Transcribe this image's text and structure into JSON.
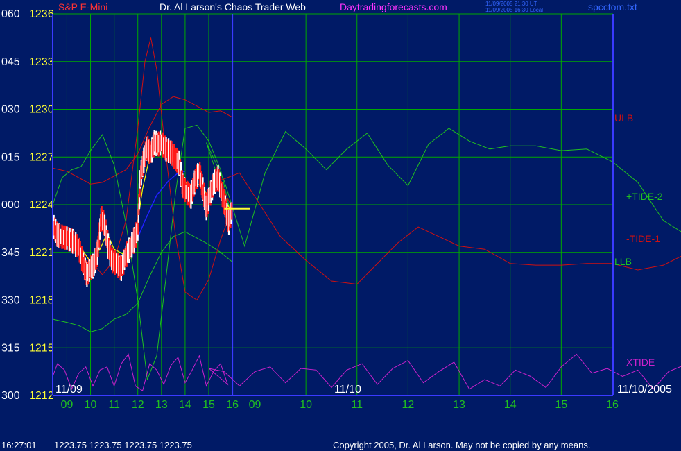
{
  "colors": {
    "background": "#001a66",
    "grid": "#00aa00",
    "axis": "#3a3aff",
    "price_up": "#ffffff",
    "price_down": "#ff1a1a",
    "ma_fast": "#ffff00",
    "ma_slow": "#2020ff",
    "ulb": "#d01010",
    "llb": "#20c020",
    "tide_plus2": "#20c020",
    "tide_minus1": "#d01010",
    "xtide": "#cc22cc",
    "label_yellow": "#ffff33",
    "label_white": "#ffffff",
    "title_white": "#ffffff",
    "title_magenta": "#ff33ff",
    "instrument_red": "#ff3333",
    "clock_blue": "#3366ff"
  },
  "header": {
    "instrument": "S&P E-Mini",
    "site_name": "Dr. Al Larson's Chaos Trader Web",
    "site_url": "Daytradingforecasts.com",
    "time_ut": "11/09/2005 21:30 UT",
    "time_local": "11/09/2005 16:30 Local",
    "filename": "spcctom.txt"
  },
  "chart_data": {
    "type": "line",
    "title": "S&P E-Mini",
    "xlabel": "",
    "ylabel": "",
    "y_left_degree_ticks": [
      "060",
      "045",
      "030",
      "015",
      "000",
      "345",
      "330",
      "315",
      "300"
    ],
    "y_left_price_ticks": [
      "1236",
      "1233",
      "1230",
      "1227",
      "1224",
      "1221",
      "1218",
      "1215",
      "1212"
    ],
    "ylim": [
      1212,
      1236
    ],
    "x_hour_ticks": [
      "09",
      "10",
      "11",
      "12",
      "13",
      "14",
      "15",
      "16",
      "09",
      "10",
      "11",
      "12",
      "13",
      "14",
      "15",
      "16"
    ],
    "x_date_labels": [
      "11/09",
      "11/10",
      "11/10/2005"
    ],
    "x_range_hours": [
      8.4,
      32.1
    ],
    "series_labels": {
      "ulb": "ULB",
      "tide_plus2": "+TIDE-2",
      "tide_minus1": "-TIDE-1",
      "llb": "LLB",
      "xtide": "XTIDE"
    },
    "price_bars": [
      [
        8.45,
        1222.6
      ],
      [
        8.6,
        1222.1
      ],
      [
        8.75,
        1222.0
      ],
      [
        9.0,
        1221.9
      ],
      [
        9.25,
        1221.7
      ],
      [
        9.5,
        1221.3
      ],
      [
        9.7,
        1220.3
      ],
      [
        9.85,
        1219.6
      ],
      [
        10.0,
        1220.0
      ],
      [
        10.15,
        1220.2
      ],
      [
        10.3,
        1221.0
      ],
      [
        10.45,
        1223.2
      ],
      [
        10.6,
        1222.7
      ],
      [
        10.75,
        1221.4
      ],
      [
        10.9,
        1220.5
      ],
      [
        11.1,
        1220.3
      ],
      [
        11.3,
        1220.0
      ],
      [
        11.5,
        1220.8
      ],
      [
        11.7,
        1221.3
      ],
      [
        11.85,
        1221.8
      ],
      [
        12.0,
        1222.4
      ],
      [
        12.1,
        1225.6
      ],
      [
        12.25,
        1226.8
      ],
      [
        12.4,
        1227.6
      ],
      [
        12.55,
        1227.2
      ],
      [
        12.7,
        1227.9
      ],
      [
        12.85,
        1227.8
      ],
      [
        13.0,
        1227.9
      ],
      [
        13.2,
        1227.5
      ],
      [
        13.4,
        1227.3
      ],
      [
        13.6,
        1226.9
      ],
      [
        13.75,
        1226.6
      ],
      [
        13.9,
        1225.2
      ],
      [
        14.05,
        1224.8
      ],
      [
        14.25,
        1224.5
      ],
      [
        14.4,
        1225.4
      ],
      [
        14.6,
        1226.1
      ],
      [
        14.75,
        1225.0
      ],
      [
        14.9,
        1223.8
      ],
      [
        15.05,
        1224.6
      ],
      [
        15.2,
        1225.3
      ],
      [
        15.4,
        1225.7
      ],
      [
        15.55,
        1224.8
      ],
      [
        15.7,
        1223.9
      ],
      [
        15.85,
        1222.9
      ],
      [
        16.0,
        1223.75
      ]
    ],
    "ma_fast_points": [
      [
        8.45,
        1222.6
      ],
      [
        9.0,
        1222.0
      ],
      [
        9.5,
        1221.5
      ],
      [
        10.0,
        1220.4
      ],
      [
        10.4,
        1221.2
      ],
      [
        10.7,
        1222.2
      ],
      [
        11.0,
        1221.2
      ],
      [
        11.5,
        1220.8
      ],
      [
        11.9,
        1221.9
      ],
      [
        12.2,
        1225.0
      ],
      [
        12.5,
        1227.0
      ],
      [
        12.8,
        1227.6
      ],
      [
        13.1,
        1227.6
      ],
      [
        13.5,
        1227.0
      ],
      [
        13.8,
        1226.3
      ],
      [
        14.1,
        1225.1
      ],
      [
        14.4,
        1225.2
      ],
      [
        14.7,
        1225.3
      ],
      [
        15.0,
        1224.4
      ],
      [
        15.3,
        1225.1
      ],
      [
        15.55,
        1225.2
      ],
      [
        15.8,
        1224.0
      ],
      [
        16.0,
        1223.4
      ]
    ],
    "ma_slow_points": [
      [
        11.3,
        1220.6
      ],
      [
        11.8,
        1221.2
      ],
      [
        12.3,
        1223.0
      ],
      [
        12.8,
        1224.6
      ],
      [
        13.3,
        1225.5
      ],
      [
        13.7,
        1226.0
      ],
      [
        14.0,
        1226.1
      ]
    ],
    "ulb_points": [
      [
        8.4,
        1226.3
      ],
      [
        9.0,
        1226.1
      ],
      [
        9.5,
        1225.7
      ],
      [
        10.0,
        1225.3
      ],
      [
        10.5,
        1225.4
      ],
      [
        11.0,
        1225.8
      ],
      [
        11.5,
        1226.2
      ],
      [
        12.0,
        1227.2
      ],
      [
        12.5,
        1228.9
      ],
      [
        13.0,
        1230.3
      ],
      [
        13.5,
        1230.8
      ],
      [
        14.0,
        1230.6
      ],
      [
        14.5,
        1230.2
      ],
      [
        15.0,
        1229.8
      ],
      [
        15.5,
        1229.9
      ],
      [
        16.0,
        1229.5
      ]
    ],
    "llb_points": [
      [
        8.4,
        1216.8
      ],
      [
        9.0,
        1216.6
      ],
      [
        9.5,
        1216.4
      ],
      [
        10.0,
        1216.0
      ],
      [
        10.5,
        1216.2
      ],
      [
        11.0,
        1216.8
      ],
      [
        11.5,
        1217.1
      ],
      [
        12.0,
        1217.8
      ],
      [
        12.5,
        1219.5
      ],
      [
        13.0,
        1221.0
      ],
      [
        13.5,
        1222.0
      ],
      [
        14.0,
        1222.3
      ],
      [
        14.5,
        1221.9
      ],
      [
        15.0,
        1221.5
      ],
      [
        15.5,
        1221.0
      ],
      [
        16.0,
        1220.4
      ]
    ],
    "tide_plus2_points": [
      [
        8.4,
        1224.0
      ],
      [
        8.8,
        1225.7
      ],
      [
        9.2,
        1226.2
      ],
      [
        9.6,
        1226.4
      ],
      [
        10.0,
        1227.4
      ],
      [
        10.5,
        1228.4
      ],
      [
        11.0,
        1226.5
      ],
      [
        11.5,
        1222.8
      ],
      [
        12.0,
        1218.0
      ],
      [
        12.4,
        1213.0
      ],
      [
        12.8,
        1214.5
      ],
      [
        13.2,
        1219.5
      ],
      [
        13.6,
        1224.8
      ],
      [
        14.0,
        1228.8
      ],
      [
        14.5,
        1229.0
      ],
      [
        15.0,
        1228.0
      ],
      [
        15.5,
        1226.2
      ],
      [
        16.0,
        1223.0
      ],
      [
        16.05,
        1227.9
      ],
      [
        16.4,
        1225.5
      ],
      [
        16.8,
        1221.4
      ],
      [
        17.2,
        1226.0
      ],
      [
        17.6,
        1228.6
      ],
      [
        18.0,
        1227.5
      ],
      [
        18.4,
        1226.2
      ],
      [
        18.8,
        1227.5
      ],
      [
        19.2,
        1228.5
      ],
      [
        19.6,
        1226.5
      ],
      [
        20.0,
        1225.2
      ],
      [
        20.4,
        1227.8
      ],
      [
        20.8,
        1228.8
      ],
      [
        21.2,
        1228.0
      ],
      [
        21.6,
        1227.5
      ],
      [
        22.0,
        1227.7
      ],
      [
        22.5,
        1227.7
      ],
      [
        23.0,
        1227.4
      ],
      [
        23.5,
        1227.5
      ],
      [
        24.0,
        1226.7
      ],
      [
        24.5,
        1225.4
      ],
      [
        25.0,
        1223.0
      ],
      [
        25.5,
        1222.0
      ],
      [
        26.0,
        1221.8
      ],
      [
        26.4,
        1222.4
      ],
      [
        26.8,
        1223.6
      ],
      [
        27.2,
        1224.8
      ],
      [
        27.6,
        1226.4
      ],
      [
        28.0,
        1227.1
      ],
      [
        28.4,
        1228.6
      ],
      [
        28.8,
        1228.9
      ],
      [
        29.2,
        1227.5
      ],
      [
        29.6,
        1226.1
      ],
      [
        30.0,
        1225.0
      ],
      [
        30.4,
        1223.2
      ],
      [
        30.8,
        1222.0
      ],
      [
        31.2,
        1221.4
      ],
      [
        31.6,
        1221.2
      ],
      [
        32.0,
        1224.2
      ]
    ],
    "tide_minus1_points": [
      [
        8.4,
        1222.5
      ],
      [
        8.8,
        1221.3
      ],
      [
        9.2,
        1221.5
      ],
      [
        9.6,
        1221.1
      ],
      [
        10.0,
        1220.5
      ],
      [
        10.5,
        1219.6
      ],
      [
        11.0,
        1220.5
      ],
      [
        11.5,
        1223.0
      ],
      [
        12.0,
        1228.8
      ],
      [
        12.3,
        1233.0
      ],
      [
        12.55,
        1234.5
      ],
      [
        12.8,
        1232.5
      ],
      [
        13.2,
        1227.0
      ],
      [
        13.6,
        1222.0
      ],
      [
        14.0,
        1218.5
      ],
      [
        14.5,
        1218.0
      ],
      [
        15.0,
        1219.3
      ],
      [
        15.5,
        1221.8
      ],
      [
        16.0,
        1223.8
      ],
      [
        16.3,
        1225.5
      ],
      [
        16.7,
        1226.0
      ],
      [
        17.0,
        1224.5
      ],
      [
        17.5,
        1222.0
      ],
      [
        18.0,
        1220.5
      ],
      [
        18.5,
        1219.2
      ],
      [
        19.0,
        1219.0
      ],
      [
        19.4,
        1220.3
      ],
      [
        19.8,
        1221.6
      ],
      [
        20.2,
        1222.6
      ],
      [
        20.6,
        1222.0
      ],
      [
        21.0,
        1221.4
      ],
      [
        21.5,
        1221.2
      ],
      [
        22.0,
        1220.3
      ],
      [
        22.5,
        1220.2
      ],
      [
        23.0,
        1220.2
      ],
      [
        23.5,
        1220.3
      ],
      [
        24.0,
        1220.3
      ],
      [
        24.5,
        1219.9
      ],
      [
        25.0,
        1220.2
      ],
      [
        25.5,
        1221.0
      ],
      [
        26.0,
        1221.2
      ],
      [
        26.4,
        1221.0
      ],
      [
        26.8,
        1221.0
      ],
      [
        27.3,
        1220.9
      ],
      [
        27.7,
        1221.8
      ],
      [
        28.0,
        1223.5
      ],
      [
        28.4,
        1225.3
      ],
      [
        28.8,
        1225.8
      ],
      [
        29.2,
        1225.4
      ],
      [
        29.6,
        1225.8
      ],
      [
        30.0,
        1225.6
      ],
      [
        30.4,
        1225.2
      ],
      [
        30.8,
        1223.8
      ],
      [
        31.2,
        1222.3
      ],
      [
        31.6,
        1221.9
      ],
      [
        32.0,
        1221.5
      ]
    ],
    "xtide_points": [
      [
        8.4,
        1213.2
      ],
      [
        8.6,
        1214.0
      ],
      [
        8.9,
        1213.6
      ],
      [
        9.2,
        1212.4
      ],
      [
        9.5,
        1213.4
      ],
      [
        9.8,
        1213.8
      ],
      [
        10.1,
        1212.6
      ],
      [
        10.4,
        1213.6
      ],
      [
        10.7,
        1213.8
      ],
      [
        11.0,
        1212.6
      ],
      [
        11.3,
        1214.0
      ],
      [
        11.6,
        1214.6
      ],
      [
        11.9,
        1212.6
      ],
      [
        12.2,
        1212.3
      ],
      [
        12.5,
        1214.0
      ],
      [
        12.8,
        1213.6
      ],
      [
        13.1,
        1212.7
      ],
      [
        13.4,
        1213.9
      ],
      [
        13.7,
        1214.4
      ],
      [
        14.0,
        1212.8
      ],
      [
        14.3,
        1213.6
      ],
      [
        14.6,
        1214.5
      ],
      [
        14.9,
        1212.6
      ],
      [
        15.2,
        1213.5
      ],
      [
        15.5,
        1214.0
      ],
      [
        15.8,
        1212.7
      ],
      [
        16.1,
        1213.7
      ],
      [
        16.4,
        1213.5
      ],
      [
        16.7,
        1212.6
      ],
      [
        17.0,
        1213.5
      ],
      [
        17.3,
        1213.8
      ],
      [
        17.6,
        1212.8
      ],
      [
        17.9,
        1213.7
      ],
      [
        18.2,
        1213.6
      ],
      [
        18.5,
        1212.5
      ],
      [
        18.8,
        1213.6
      ],
      [
        19.1,
        1214.0
      ],
      [
        19.4,
        1212.7
      ],
      [
        19.7,
        1213.7
      ],
      [
        20.0,
        1214.2
      ],
      [
        20.3,
        1212.8
      ],
      [
        20.6,
        1213.5
      ],
      [
        20.9,
        1214.1
      ],
      [
        21.2,
        1212.4
      ],
      [
        21.5,
        1213.0
      ],
      [
        21.8,
        1212.6
      ],
      [
        22.1,
        1213.6
      ],
      [
        22.4,
        1213.2
      ],
      [
        22.7,
        1212.5
      ],
      [
        23.0,
        1213.8
      ],
      [
        23.3,
        1214.6
      ],
      [
        23.6,
        1213.4
      ],
      [
        23.9,
        1213.7
      ],
      [
        24.2,
        1213.2
      ],
      [
        24.5,
        1213.6
      ],
      [
        24.8,
        1212.4
      ],
      [
        25.1,
        1213.5
      ],
      [
        25.4,
        1213.9
      ],
      [
        25.7,
        1213.0
      ],
      [
        26.0,
        1213.6
      ],
      [
        26.3,
        1213.9
      ],
      [
        26.6,
        1212.8
      ],
      [
        26.9,
        1213.4
      ],
      [
        27.2,
        1214.0
      ],
      [
        27.5,
        1213.4
      ],
      [
        27.8,
        1213.6
      ],
      [
        28.1,
        1212.8
      ],
      [
        28.4,
        1213.6
      ],
      [
        28.7,
        1213.5
      ],
      [
        29.0,
        1212.6
      ],
      [
        29.3,
        1213.4
      ],
      [
        29.6,
        1214.1
      ],
      [
        29.9,
        1213.2
      ],
      [
        30.2,
        1213.9
      ],
      [
        30.5,
        1213.5
      ],
      [
        30.8,
        1212.7
      ],
      [
        31.1,
        1213.6
      ],
      [
        31.4,
        1213.9
      ],
      [
        31.7,
        1212.8
      ],
      [
        32.0,
        1213.5
      ]
    ],
    "last_price_marker": 1223.75,
    "last_price_marker_range": [
      16.4,
      16.9
    ],
    "grid": true
  },
  "footer": {
    "clock": "16:27:01",
    "ohlc": "1223.75 1223.75 1223.75 1223.75",
    "copyright": "Copyright 2005, Dr. Al Larson. May not be copied by any means."
  }
}
